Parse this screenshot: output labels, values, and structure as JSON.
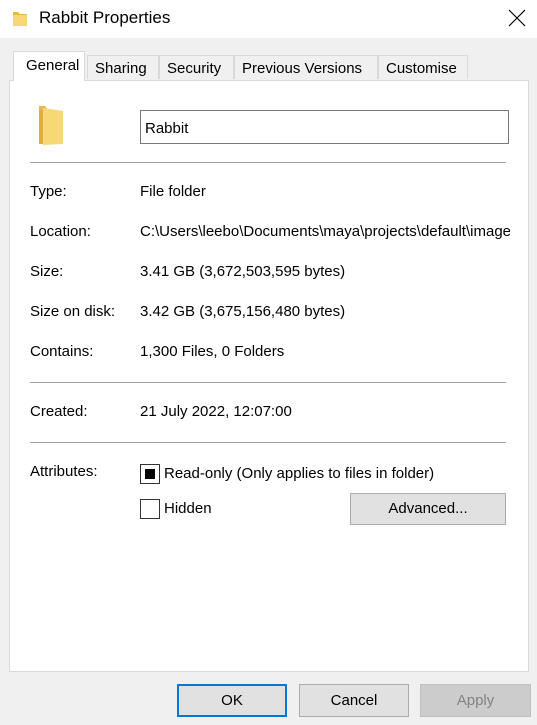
{
  "window": {
    "title": "Rabbit Properties",
    "icons": {
      "title": "folder-icon",
      "close": "close-icon"
    }
  },
  "tabs": [
    {
      "label": "General",
      "active": true
    },
    {
      "label": "Sharing",
      "active": false
    },
    {
      "label": "Security",
      "active": false
    },
    {
      "label": "Previous Versions",
      "active": false
    },
    {
      "label": "Customise",
      "active": false
    }
  ],
  "general": {
    "folder_icon": "folder-icon",
    "name_value": "Rabbit",
    "type_label": "Type:",
    "type_value": "File folder",
    "location_label": "Location:",
    "location_value": "C:\\Users\\leebo\\Documents\\maya\\projects\\default\\images",
    "size_label": "Size:",
    "size_value": "3.41 GB (3,672,503,595 bytes)",
    "size_on_disk_label": "Size on disk:",
    "size_on_disk_value": "3.42 GB (3,675,156,480 bytes)",
    "contains_label": "Contains:",
    "contains_value": "1,300 Files, 0 Folders",
    "created_label": "Created:",
    "created_value": "21 July 2022, 12:07:00",
    "attributes_label": "Attributes:",
    "readonly_label": "Read-only (Only applies to files in folder)",
    "readonly_state": "indeterminate",
    "hidden_label": "Hidden",
    "hidden_checked": false,
    "advanced_label": "Advanced..."
  },
  "footer": {
    "ok_label": "OK",
    "cancel_label": "Cancel",
    "apply_label": "Apply",
    "apply_enabled": false
  },
  "colors": {
    "folder_yellow": "#f8d775",
    "accent_blue": "#0078d7",
    "window_bg": "#f0f0f0"
  }
}
